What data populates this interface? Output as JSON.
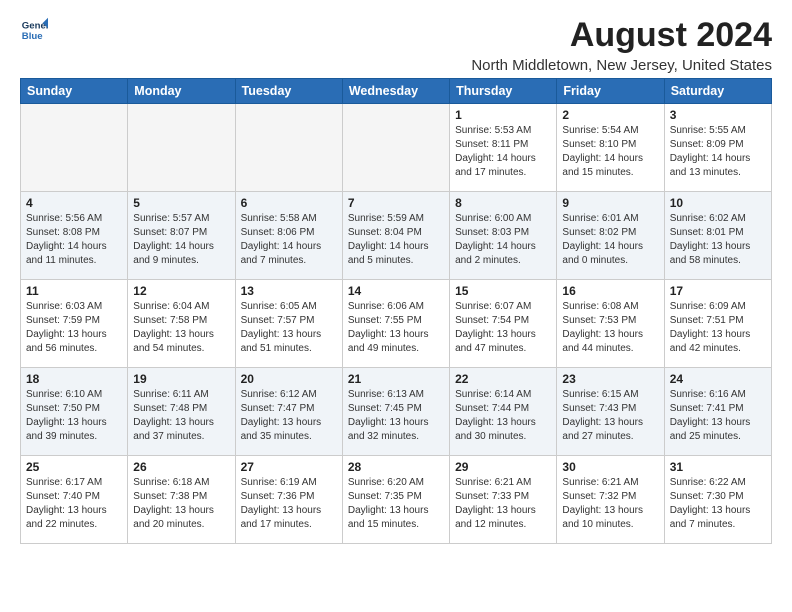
{
  "header": {
    "logo_line1": "General",
    "logo_line2": "Blue",
    "title": "August 2024",
    "subtitle": "North Middletown, New Jersey, United States"
  },
  "columns": [
    "Sunday",
    "Monday",
    "Tuesday",
    "Wednesday",
    "Thursday",
    "Friday",
    "Saturday"
  ],
  "weeks": [
    [
      {
        "day": "",
        "info": "",
        "empty": true
      },
      {
        "day": "",
        "info": "",
        "empty": true
      },
      {
        "day": "",
        "info": "",
        "empty": true
      },
      {
        "day": "",
        "info": "",
        "empty": true
      },
      {
        "day": "1",
        "info": "Sunrise: 5:53 AM\nSunset: 8:11 PM\nDaylight: 14 hours\nand 17 minutes."
      },
      {
        "day": "2",
        "info": "Sunrise: 5:54 AM\nSunset: 8:10 PM\nDaylight: 14 hours\nand 15 minutes."
      },
      {
        "day": "3",
        "info": "Sunrise: 5:55 AM\nSunset: 8:09 PM\nDaylight: 14 hours\nand 13 minutes."
      }
    ],
    [
      {
        "day": "4",
        "info": "Sunrise: 5:56 AM\nSunset: 8:08 PM\nDaylight: 14 hours\nand 11 minutes."
      },
      {
        "day": "5",
        "info": "Sunrise: 5:57 AM\nSunset: 8:07 PM\nDaylight: 14 hours\nand 9 minutes."
      },
      {
        "day": "6",
        "info": "Sunrise: 5:58 AM\nSunset: 8:06 PM\nDaylight: 14 hours\nand 7 minutes."
      },
      {
        "day": "7",
        "info": "Sunrise: 5:59 AM\nSunset: 8:04 PM\nDaylight: 14 hours\nand 5 minutes."
      },
      {
        "day": "8",
        "info": "Sunrise: 6:00 AM\nSunset: 8:03 PM\nDaylight: 14 hours\nand 2 minutes."
      },
      {
        "day": "9",
        "info": "Sunrise: 6:01 AM\nSunset: 8:02 PM\nDaylight: 14 hours\nand 0 minutes."
      },
      {
        "day": "10",
        "info": "Sunrise: 6:02 AM\nSunset: 8:01 PM\nDaylight: 13 hours\nand 58 minutes."
      }
    ],
    [
      {
        "day": "11",
        "info": "Sunrise: 6:03 AM\nSunset: 7:59 PM\nDaylight: 13 hours\nand 56 minutes."
      },
      {
        "day": "12",
        "info": "Sunrise: 6:04 AM\nSunset: 7:58 PM\nDaylight: 13 hours\nand 54 minutes."
      },
      {
        "day": "13",
        "info": "Sunrise: 6:05 AM\nSunset: 7:57 PM\nDaylight: 13 hours\nand 51 minutes."
      },
      {
        "day": "14",
        "info": "Sunrise: 6:06 AM\nSunset: 7:55 PM\nDaylight: 13 hours\nand 49 minutes."
      },
      {
        "day": "15",
        "info": "Sunrise: 6:07 AM\nSunset: 7:54 PM\nDaylight: 13 hours\nand 47 minutes."
      },
      {
        "day": "16",
        "info": "Sunrise: 6:08 AM\nSunset: 7:53 PM\nDaylight: 13 hours\nand 44 minutes."
      },
      {
        "day": "17",
        "info": "Sunrise: 6:09 AM\nSunset: 7:51 PM\nDaylight: 13 hours\nand 42 minutes."
      }
    ],
    [
      {
        "day": "18",
        "info": "Sunrise: 6:10 AM\nSunset: 7:50 PM\nDaylight: 13 hours\nand 39 minutes."
      },
      {
        "day": "19",
        "info": "Sunrise: 6:11 AM\nSunset: 7:48 PM\nDaylight: 13 hours\nand 37 minutes."
      },
      {
        "day": "20",
        "info": "Sunrise: 6:12 AM\nSunset: 7:47 PM\nDaylight: 13 hours\nand 35 minutes."
      },
      {
        "day": "21",
        "info": "Sunrise: 6:13 AM\nSunset: 7:45 PM\nDaylight: 13 hours\nand 32 minutes."
      },
      {
        "day": "22",
        "info": "Sunrise: 6:14 AM\nSunset: 7:44 PM\nDaylight: 13 hours\nand 30 minutes."
      },
      {
        "day": "23",
        "info": "Sunrise: 6:15 AM\nSunset: 7:43 PM\nDaylight: 13 hours\nand 27 minutes."
      },
      {
        "day": "24",
        "info": "Sunrise: 6:16 AM\nSunset: 7:41 PM\nDaylight: 13 hours\nand 25 minutes."
      }
    ],
    [
      {
        "day": "25",
        "info": "Sunrise: 6:17 AM\nSunset: 7:40 PM\nDaylight: 13 hours\nand 22 minutes."
      },
      {
        "day": "26",
        "info": "Sunrise: 6:18 AM\nSunset: 7:38 PM\nDaylight: 13 hours\nand 20 minutes."
      },
      {
        "day": "27",
        "info": "Sunrise: 6:19 AM\nSunset: 7:36 PM\nDaylight: 13 hours\nand 17 minutes."
      },
      {
        "day": "28",
        "info": "Sunrise: 6:20 AM\nSunset: 7:35 PM\nDaylight: 13 hours\nand 15 minutes."
      },
      {
        "day": "29",
        "info": "Sunrise: 6:21 AM\nSunset: 7:33 PM\nDaylight: 13 hours\nand 12 minutes."
      },
      {
        "day": "30",
        "info": "Sunrise: 6:21 AM\nSunset: 7:32 PM\nDaylight: 13 hours\nand 10 minutes."
      },
      {
        "day": "31",
        "info": "Sunrise: 6:22 AM\nSunset: 7:30 PM\nDaylight: 13 hours\nand 7 minutes."
      }
    ]
  ]
}
